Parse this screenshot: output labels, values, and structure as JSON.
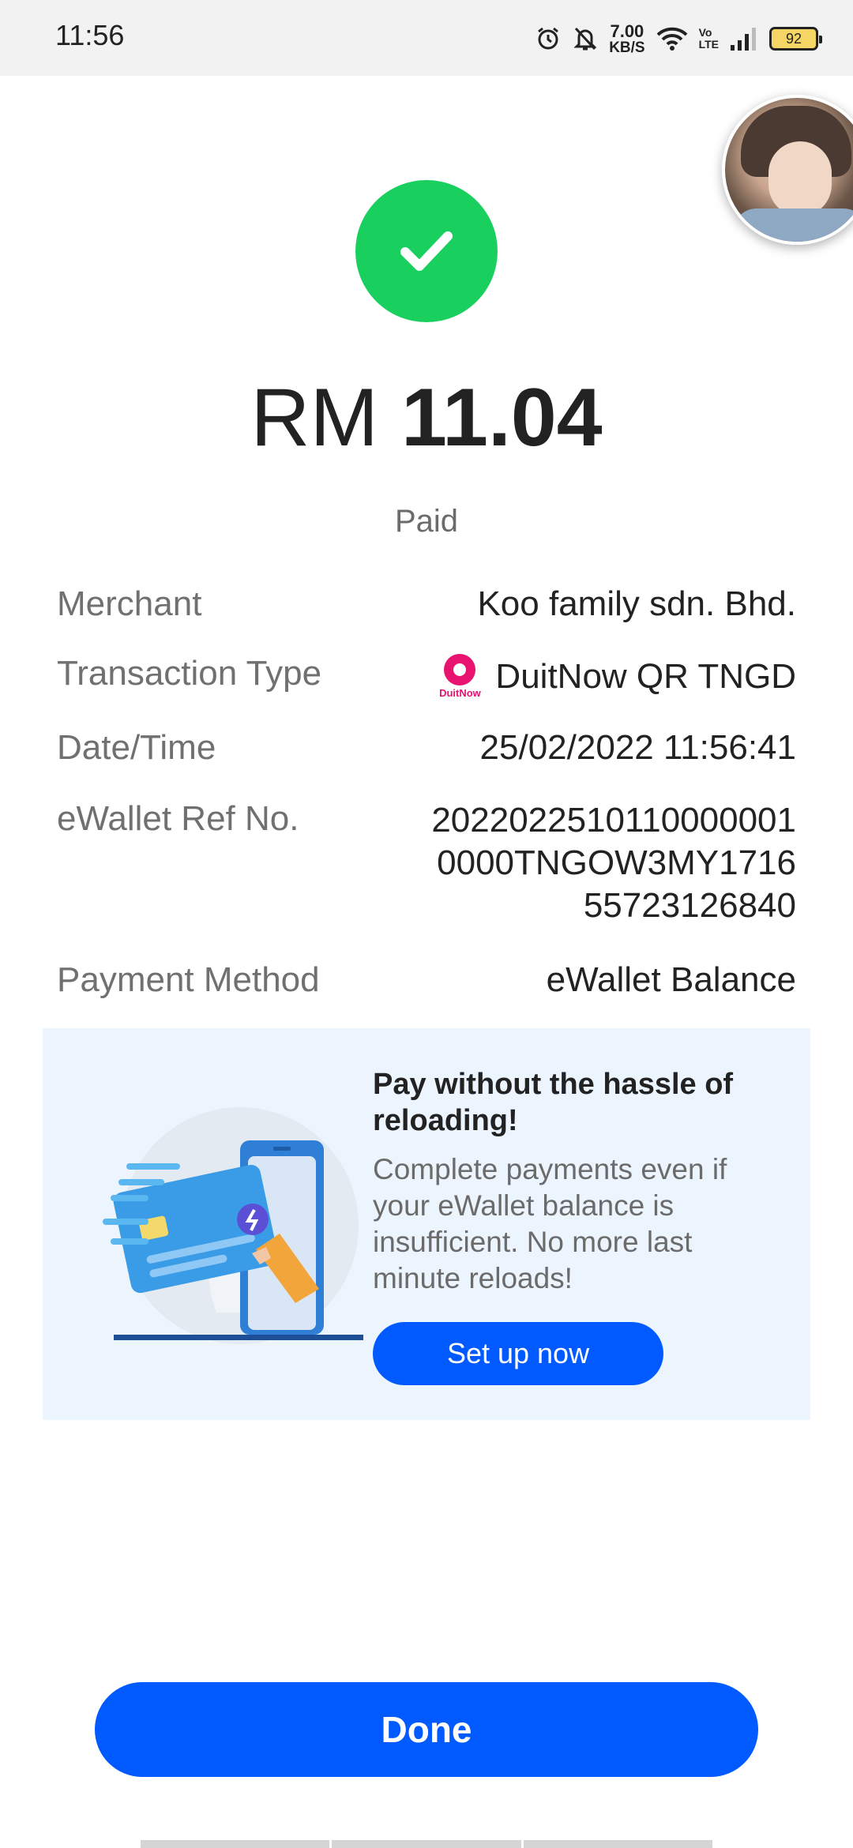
{
  "status_bar": {
    "time": "11:56",
    "net_speed_value": "7.00",
    "net_speed_unit": "KB/S",
    "volte_top": "Vo",
    "volte_bottom": "LTE",
    "battery": "92"
  },
  "receipt": {
    "currency": "RM",
    "amount": "11.04",
    "status": "Paid",
    "success_color": "#19d05f"
  },
  "details": {
    "merchant_label": "Merchant",
    "merchant_value": "Koo family sdn. Bhd.",
    "txn_type_label": "Transaction Type",
    "txn_type_value": "DuitNow QR TNGD",
    "txn_type_logo_text": "DuitNow",
    "datetime_label": "Date/Time",
    "datetime_value": "25/02/2022 11:56:41",
    "ref_label": "eWallet Ref No.",
    "ref_line1": "2022022510110000001",
    "ref_line2": "0000TNGOW3MY1716",
    "ref_line3": "55723126840",
    "payment_label": "Payment Method",
    "payment_value": "eWallet Balance"
  },
  "promo": {
    "title": "Pay without the hassle of reloading!",
    "description": "Complete payments even if your eWallet balance is insufficient. No more last minute reloads!",
    "button": "Set up now"
  },
  "done_button": "Done",
  "accent_color": "#005aff"
}
